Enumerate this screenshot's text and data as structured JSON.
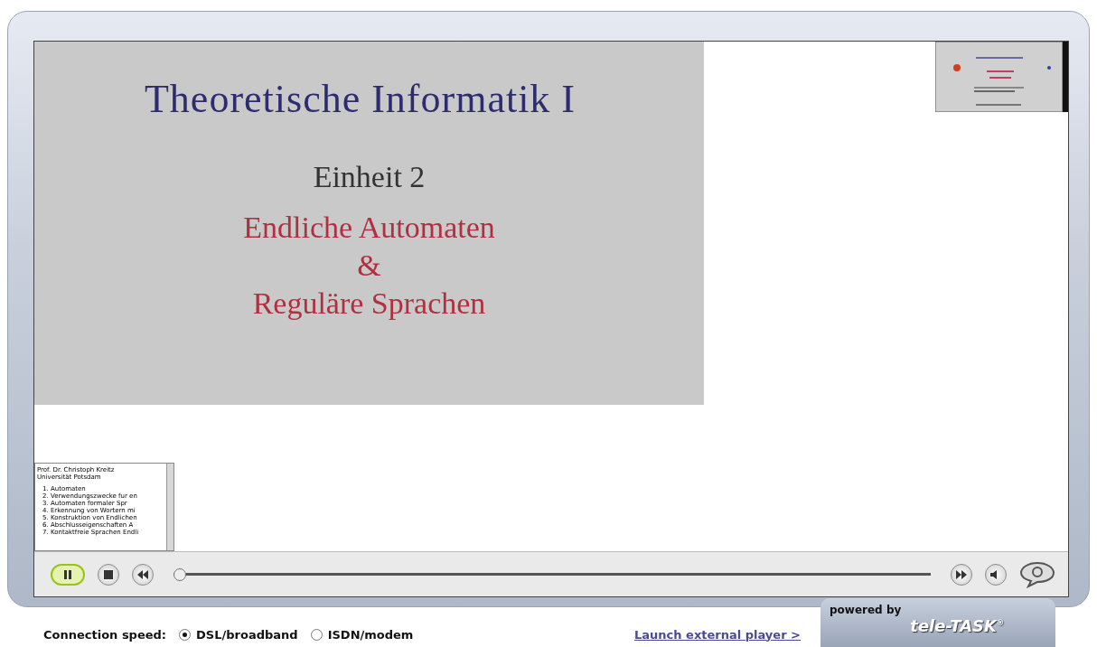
{
  "slide": {
    "title": "Theoretische Informatik I",
    "unit": "Einheit 2",
    "topic_lines": [
      "Endliche Automaten",
      "&",
      "Reguläre Sprachen"
    ]
  },
  "index": {
    "heading_lines": [
      "Prof. Dr. Christoph Kreitz",
      "Universität Potsdam"
    ],
    "items": [
      {
        "number": "1.",
        "label": "Automaten"
      },
      {
        "number": "2.",
        "label": "Verwendungszwecke fur en"
      },
      {
        "number": "3.",
        "label": "Automaten formaler Spr"
      },
      {
        "number": "4.",
        "label": "Erkennung von Wortern mi"
      },
      {
        "number": "5.",
        "label": "Konstruktion von Endlichen"
      },
      {
        "number": "6.",
        "label": "Abschlusseigenschaften A"
      },
      {
        "number": "7.",
        "label": "Kontaktfreie Sprachen Endli"
      }
    ]
  },
  "player": {
    "playing": true,
    "level": 0
  },
  "footer": {
    "label": "Connection speed:",
    "options": [
      {
        "label": "DSL/broadband",
        "selected": true
      },
      {
        "label": "ISDN/modem",
        "selected": false
      }
    ],
    "link": "Launch external player >",
    "powered_by": "powered by",
    "brand": "tele-TASK",
    "brand_mark": "®"
  }
}
